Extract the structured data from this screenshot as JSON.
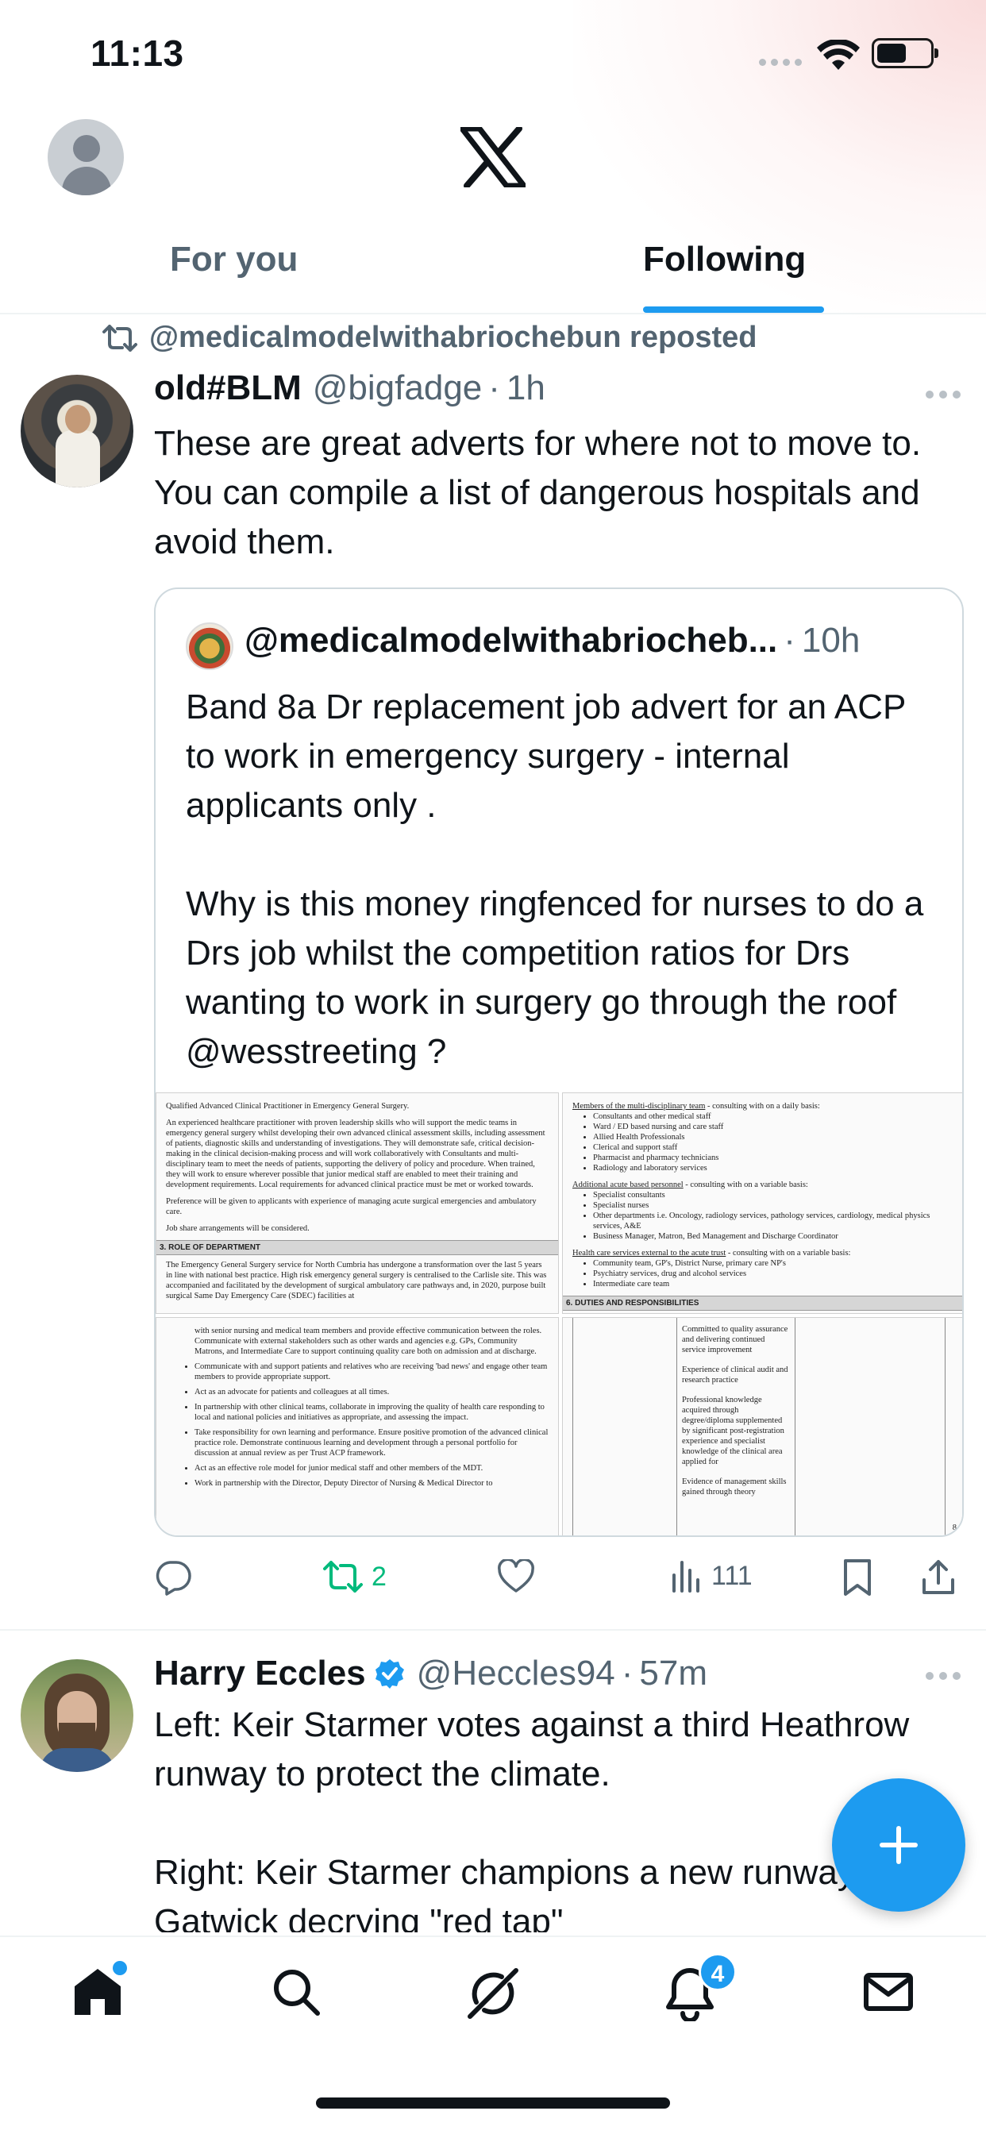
{
  "status_bar": {
    "time": "11:13",
    "battery_level_percent": 55
  },
  "header": {
    "logo": "x-logo",
    "tabs": [
      {
        "label": "For you",
        "selected": false
      },
      {
        "label": "Following",
        "selected": true
      }
    ]
  },
  "feed": {
    "tweets": [
      {
        "repost_label": "@medicalmodelwithabriochebun reposted",
        "author_name": "old#BLM",
        "handle": "@bigfadge",
        "time": "1h",
        "text": "These are great adverts for where not to move to. You can compile a list of dangerous hospitals and avoid them.",
        "quote": {
          "handle": "@medicalmodelwithabriocheb...",
          "time": "10h",
          "text": "Band 8a Dr replacement job advert for an ACP to work in emergency surgery - internal applicants only .\n\nWhy is this money ringfenced for nurses to do a Drs job whilst the competition ratios for Drs wanting to work in surgery go through the roof @wesstreeting ?",
          "documents": {
            "doc1": {
              "p1": "Qualified Advanced Clinical Practitioner in Emergency General Surgery.",
              "p2": "An experienced healthcare practitioner with proven leadership skills who will support the medic teams in emergency general surgery whilst developing their own advanced clinical assessment skills, including assessment of patients, diagnostic skills and understanding of investigations. They will demonstrate safe, critical decision-making in the clinical decision-making process and will work collaboratively with Consultants and multi-disciplinary team to meet the needs of patients, supporting the delivery of policy and procedure. When trained, they will work to ensure wherever possible that junior medical staff are enabled to meet their training and development requirements. Local requirements for advanced clinical practice must be met or worked towards.",
              "p3": "Preference will be given to applicants with experience of managing acute surgical emergencies and ambulatory care.",
              "p4": "Job share arrangements will be considered.",
              "heading": "3. ROLE OF DEPARTMENT",
              "p5": "The Emergency General Surgery service for North Cumbria has undergone a transformation over the last 5 years in line with national best practice. High risk emergency general surgery is centralised to the Carlisle site. This was accompanied and facilitated by the development of surgical ambulatory care pathways and, in 2020, purpose built surgical Same Day Emergency Care (SDEC) facilities at"
            },
            "doc2": {
              "team_heading": "Members of the multi-disciplinary team",
              "team_suffix": " - consulting with on a daily basis:",
              "team_items": [
                "Consultants and other medical staff",
                "Ward / ED based nursing and care staff",
                "Allied Health Professionals",
                "Clerical and support staff",
                "Pharmacist and pharmacy technicians",
                "Radiology and laboratory services"
              ],
              "acute_heading": "Additional acute based personnel",
              "acute_suffix": " - consulting with on a variable basis:",
              "acute_items": [
                "Specialist consultants",
                "Specialist nurses",
                "Other departments i.e. Oncology, radiology services, pathology services, cardiology, medical physics services, A&E",
                "Business Manager, Matron, Bed Management and Discharge Coordinator"
              ],
              "external_heading": "Health care services external to the acute trust",
              "external_suffix": " - consulting with on a variable basis:",
              "external_items": [
                "Community team, GP's, District Nurse, primary care NP's",
                "Psychiatry services, drug and alcohol services",
                "Intermediate care team"
              ],
              "footer_heading": "6. DUTIES AND RESPONSIBILITIES"
            },
            "doc3": {
              "items": [
                "with senior nursing and medical team members and provide effective communication between the roles. Communicate with external stakeholders such as other wards and agencies e.g. GPs, Community Matrons, and Intermediate Care to support continuing quality care both on admission and at discharge.",
                "Communicate with and support patients and relatives who are receiving 'bad news' and engage other team members to provide appropriate support.",
                "Act as an advocate for patients and colleagues at all times.",
                "In partnership with other clinical teams, collaborate in improving the quality of health care responding to local and national policies and initiatives as appropriate, and assessing the impact.",
                "Take responsibility for own learning and performance. Ensure positive promotion of the advanced clinical practice role. Demonstrate continuous learning and development through a personal portfolio for discussion at annual review as per Trust ACP framework.",
                "Act as an effective role model for junior medical staff and other members of the MDT.",
                "Work in partnership with the Director, Deputy Director of Nursing & Medical Director to"
              ]
            },
            "doc4": {
              "p1": "Committed to quality assurance and delivering continued service improvement",
              "p2": "Experience of clinical audit and research practice",
              "p3": "Professional knowledge acquired through degree/diploma supplemented by significant post-registration experience and specialist knowledge of the clinical area applied for",
              "p4": "Evidence of management skills gained through theory",
              "page_number": "8"
            }
          }
        },
        "actions": {
          "replies": "",
          "reposts": "2",
          "likes": "",
          "views": "111"
        }
      },
      {
        "author_name": "Harry Eccles",
        "verified": true,
        "handle": "@Heccles94",
        "time": "57m",
        "text": "Left: Keir Starmer votes against a third Heathrow runway to protect the climate.\n\nRight: Keir Starmer champions a new runway at Gatwick decrying \"red tap\""
      }
    ]
  },
  "bottom_nav": {
    "items": [
      "home-icon",
      "search-icon",
      "grok-icon",
      "notifications-icon",
      "messages-icon"
    ],
    "notification_count": "4"
  },
  "colors": {
    "accent": "#1d9bf0",
    "repost_green": "#00ba7c",
    "secondary_text": "#536471",
    "primary_text": "#0f1419"
  }
}
